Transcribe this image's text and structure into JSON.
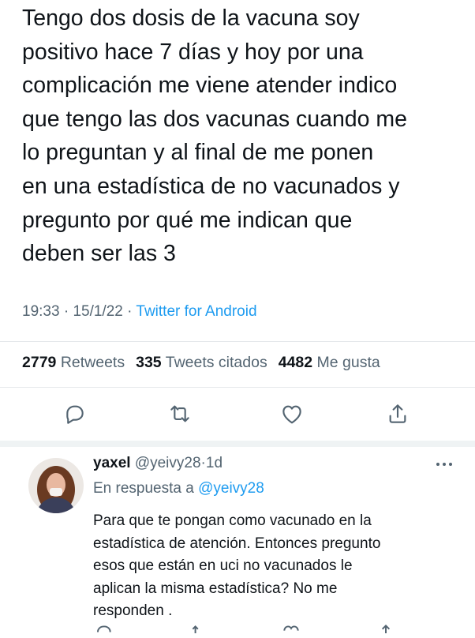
{
  "tweet": {
    "text_lines": [
      "Tengo dos dosis de la vacuna soy",
      "positivo hace 7 días y hoy por una",
      "complicación me viene atender indico",
      "que tengo las dos vacunas cuando me",
      "lo preguntan y al final de  me ponen",
      "en una estadística de no vacunados y",
      "pregunto por qué me indican que",
      "deben ser las 3"
    ],
    "time": "19:33",
    "date": "15/1/22",
    "separator": "·",
    "source": "Twitter for Android",
    "stats": {
      "retweets_count": "2779",
      "retweets_label": "Retweets",
      "quotes_count": "335",
      "quotes_label": "Tweets citados",
      "likes_count": "4482",
      "likes_label": "Me gusta"
    },
    "actions": [
      "reply-icon",
      "retweet-icon",
      "like-icon",
      "share-icon"
    ]
  },
  "reply": {
    "name": "yaxel",
    "handle": "@yeivy28",
    "separator": "·",
    "age": "1d",
    "replying_prefix": "En respuesta a",
    "replying_to": "@yeivy28",
    "text_lines": [
      "Para que te pongan como vacunado en la",
      "estadística de atención. Entonces pregunto",
      "esos que están en uci no vacunados le",
      "aplican la misma estadística?  No me",
      "responden ."
    ]
  },
  "colors": {
    "text": "#0f1419",
    "secondary": "#536471",
    "accent": "#1d9bf0",
    "divider": "#e5e8eb"
  }
}
